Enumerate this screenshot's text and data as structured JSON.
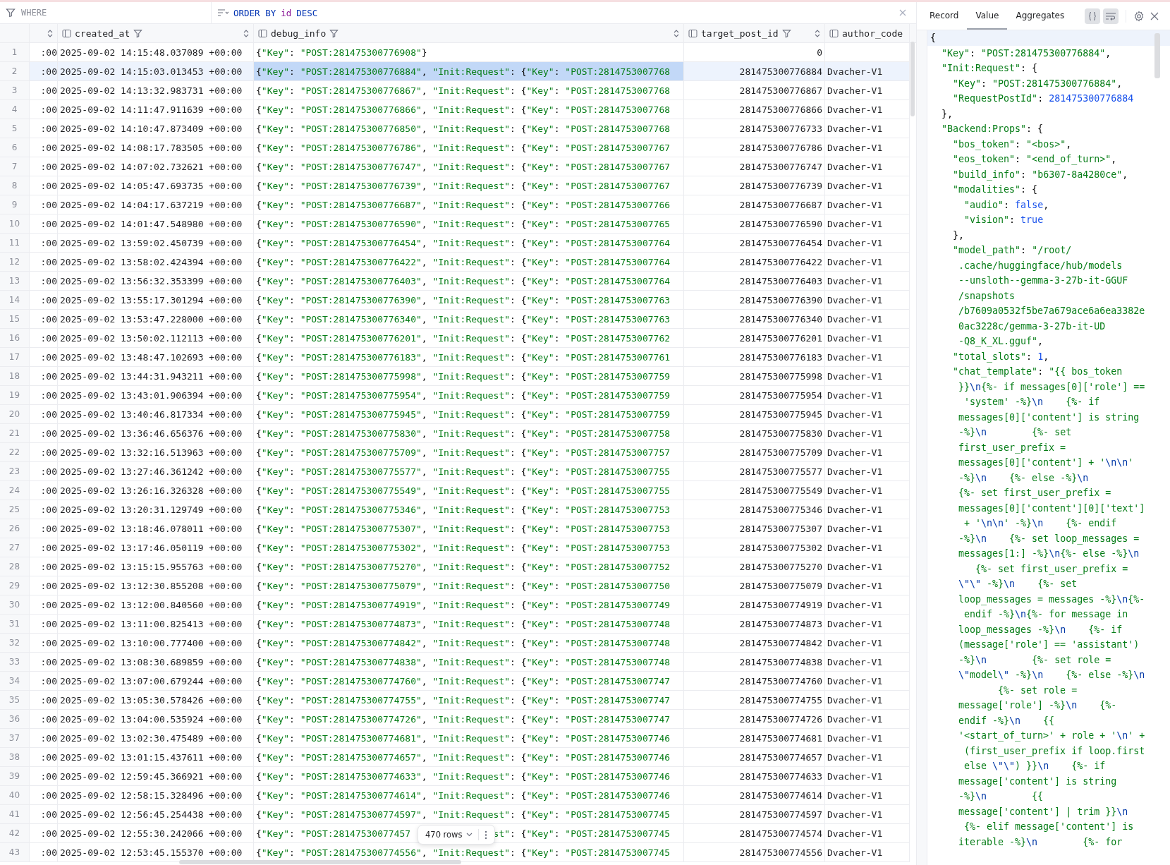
{
  "filter_bar": {
    "where_placeholder": "WHERE",
    "order_by": [
      {
        "text": "ORDER BY",
        "kind": "keyword"
      },
      {
        "text": "id",
        "kind": "identifier"
      },
      {
        "text": "DESC",
        "kind": "keyword"
      }
    ]
  },
  "table": {
    "columns": [
      {
        "sortable": true,
        "filter": false,
        "icon": false
      },
      {
        "name": "created_at",
        "sortable": true,
        "filter": true,
        "icon": true
      },
      {
        "name": "debug_info",
        "sortable": true,
        "filter": true,
        "icon": true
      },
      {
        "name": "target_post_id",
        "sortable": true,
        "filter": true,
        "icon": true
      },
      {
        "name": "author_code",
        "sortable": false,
        "filter": false,
        "icon": true
      }
    ],
    "rows": [
      {
        "number": "1",
        "column_1": ":00",
        "created_at": "2025-09-02 14:15:48.037089 +00:00",
        "debug_info": "{\"Key\": \"POST:281475300776908\"}",
        "target_post_id": "0",
        "selected": false
      },
      {
        "number": "2",
        "column_1": ":00",
        "created_at": "2025-09-02 14:15:03.013453 +00:00",
        "debug_info": "{\"Key\": \"POST:281475300776884\", \"Init:Request\": {\"Key\": \"POST:2814753007768",
        "target_post_id": "281475300776884",
        "author_code": "Dvacher-V1",
        "selected": true
      },
      {
        "number": "3",
        "column_1": ":00",
        "created_at": "2025-09-02 14:13:32.983731 +00:00",
        "debug_info": "{\"Key\": \"POST:281475300776867\", \"Init:Request\": {\"Key\": \"POST:2814753007768",
        "target_post_id": "281475300776867",
        "author_code": "Dvacher-V1",
        "selected": false
      },
      {
        "number": "4",
        "column_1": ":00",
        "created_at": "2025-09-02 14:11:47.911639 +00:00",
        "debug_info": "{\"Key\": \"POST:281475300776866\", \"Init:Request\": {\"Key\": \"POST:2814753007768",
        "target_post_id": "281475300776866",
        "author_code": "Dvacher-V1",
        "selected": false
      },
      {
        "number": "5",
        "column_1": ":00",
        "created_at": "2025-09-02 14:10:47.873409 +00:00",
        "debug_info": "{\"Key\": \"POST:281475300776850\", \"Init:Request\": {\"Key\": \"POST:2814753007768",
        "target_post_id": "281475300776733",
        "author_code": "Dvacher-V1",
        "selected": false
      },
      {
        "number": "6",
        "column_1": ":00",
        "created_at": "2025-09-02 14:08:17.783505 +00:00",
        "debug_info": "{\"Key\": \"POST:281475300776786\", \"Init:Request\": {\"Key\": \"POST:2814753007767",
        "target_post_id": "281475300776786",
        "author_code": "Dvacher-V1",
        "selected": false
      },
      {
        "number": "7",
        "column_1": ":00",
        "created_at": "2025-09-02 14:07:02.732621 +00:00",
        "debug_info": "{\"Key\": \"POST:281475300776747\", \"Init:Request\": {\"Key\": \"POST:2814753007767",
        "target_post_id": "281475300776747",
        "author_code": "Dvacher-V1",
        "selected": false
      },
      {
        "number": "8",
        "column_1": ":00",
        "created_at": "2025-09-02 14:05:47.693735 +00:00",
        "debug_info": "{\"Key\": \"POST:281475300776739\", \"Init:Request\": {\"Key\": \"POST:2814753007767",
        "target_post_id": "281475300776739",
        "author_code": "Dvacher-V1",
        "selected": false
      },
      {
        "number": "9",
        "column_1": ":00",
        "created_at": "2025-09-02 14:04:17.637219 +00:00",
        "debug_info": "{\"Key\": \"POST:281475300776687\", \"Init:Request\": {\"Key\": \"POST:2814753007766",
        "target_post_id": "281475300776687",
        "author_code": "Dvacher-V1",
        "selected": false
      },
      {
        "number": "10",
        "column_1": ":00",
        "created_at": "2025-09-02 14:01:47.548980 +00:00",
        "debug_info": "{\"Key\": \"POST:281475300776590\", \"Init:Request\": {\"Key\": \"POST:2814753007765",
        "target_post_id": "281475300776590",
        "author_code": "Dvacher-V1",
        "selected": false
      },
      {
        "number": "11",
        "column_1": ":00",
        "created_at": "2025-09-02 13:59:02.450739 +00:00",
        "debug_info": "{\"Key\": \"POST:281475300776454\", \"Init:Request\": {\"Key\": \"POST:2814753007764",
        "target_post_id": "281475300776454",
        "author_code": "Dvacher-V1",
        "selected": false
      },
      {
        "number": "12",
        "column_1": ":00",
        "created_at": "2025-09-02 13:58:02.424394 +00:00",
        "debug_info": "{\"Key\": \"POST:281475300776422\", \"Init:Request\": {\"Key\": \"POST:2814753007764",
        "target_post_id": "281475300776422",
        "author_code": "Dvacher-V1",
        "selected": false
      },
      {
        "number": "13",
        "column_1": ":00",
        "created_at": "2025-09-02 13:56:32.353399 +00:00",
        "debug_info": "{\"Key\": \"POST:281475300776403\", \"Init:Request\": {\"Key\": \"POST:2814753007764",
        "target_post_id": "281475300776403",
        "author_code": "Dvacher-V1",
        "selected": false
      },
      {
        "number": "14",
        "column_1": ":00",
        "created_at": "2025-09-02 13:55:17.301294 +00:00",
        "debug_info": "{\"Key\": \"POST:281475300776390\", \"Init:Request\": {\"Key\": \"POST:2814753007763",
        "target_post_id": "281475300776390",
        "author_code": "Dvacher-V1",
        "selected": false
      },
      {
        "number": "15",
        "column_1": ":00",
        "created_at": "2025-09-02 13:53:47.228000 +00:00",
        "debug_info": "{\"Key\": \"POST:281475300776340\", \"Init:Request\": {\"Key\": \"POST:2814753007763",
        "target_post_id": "281475300776340",
        "author_code": "Dvacher-V1",
        "selected": false
      },
      {
        "number": "16",
        "column_1": ":00",
        "created_at": "2025-09-02 13:50:02.112113 +00:00",
        "debug_info": "{\"Key\": \"POST:281475300776201\", \"Init:Request\": {\"Key\": \"POST:2814753007762",
        "target_post_id": "281475300776201",
        "author_code": "Dvacher-V1",
        "selected": false
      },
      {
        "number": "17",
        "column_1": ":00",
        "created_at": "2025-09-02 13:48:47.102693 +00:00",
        "debug_info": "{\"Key\": \"POST:281475300776183\", \"Init:Request\": {\"Key\": \"POST:2814753007761",
        "target_post_id": "281475300776183",
        "author_code": "Dvacher-V1",
        "selected": false
      },
      {
        "number": "18",
        "column_1": ":00",
        "created_at": "2025-09-02 13:44:31.943211 +00:00",
        "debug_info": "{\"Key\": \"POST:281475300775998\", \"Init:Request\": {\"Key\": \"POST:2814753007759",
        "target_post_id": "281475300775998",
        "author_code": "Dvacher-V1",
        "selected": false
      },
      {
        "number": "19",
        "column_1": ":00",
        "created_at": "2025-09-02 13:43:01.906394 +00:00",
        "debug_info": "{\"Key\": \"POST:281475300775954\", \"Init:Request\": {\"Key\": \"POST:2814753007759",
        "target_post_id": "281475300775954",
        "author_code": "Dvacher-V1",
        "selected": false
      },
      {
        "number": "20",
        "column_1": ":00",
        "created_at": "2025-09-02 13:40:46.817334 +00:00",
        "debug_info": "{\"Key\": \"POST:281475300775945\", \"Init:Request\": {\"Key\": \"POST:2814753007759",
        "target_post_id": "281475300775945",
        "author_code": "Dvacher-V1",
        "selected": false
      },
      {
        "number": "21",
        "column_1": ":00",
        "created_at": "2025-09-02 13:36:46.656376 +00:00",
        "debug_info": "{\"Key\": \"POST:281475300775830\", \"Init:Request\": {\"Key\": \"POST:2814753007758",
        "target_post_id": "281475300775830",
        "author_code": "Dvacher-V1",
        "selected": false
      },
      {
        "number": "22",
        "column_1": ":00",
        "created_at": "2025-09-02 13:32:16.513963 +00:00",
        "debug_info": "{\"Key\": \"POST:281475300775709\", \"Init:Request\": {\"Key\": \"POST:2814753007757",
        "target_post_id": "281475300775709",
        "author_code": "Dvacher-V1",
        "selected": false
      },
      {
        "number": "23",
        "column_1": ":00",
        "created_at": "2025-09-02 13:27:46.361242 +00:00",
        "debug_info": "{\"Key\": \"POST:281475300775577\", \"Init:Request\": {\"Key\": \"POST:2814753007755",
        "target_post_id": "281475300775577",
        "author_code": "Dvacher-V1",
        "selected": false
      },
      {
        "number": "24",
        "column_1": ":00",
        "created_at": "2025-09-02 13:26:16.326328 +00:00",
        "debug_info": "{\"Key\": \"POST:281475300775549\", \"Init:Request\": {\"Key\": \"POST:2814753007755",
        "target_post_id": "281475300775549",
        "author_code": "Dvacher-V1",
        "selected": false
      },
      {
        "number": "25",
        "column_1": ":00",
        "created_at": "2025-09-02 13:20:31.129749 +00:00",
        "debug_info": "{\"Key\": \"POST:281475300775346\", \"Init:Request\": {\"Key\": \"POST:2814753007753",
        "target_post_id": "281475300775346",
        "author_code": "Dvacher-V1",
        "selected": false
      },
      {
        "number": "26",
        "column_1": ":00",
        "created_at": "2025-09-02 13:18:46.078011 +00:00",
        "debug_info": "{\"Key\": \"POST:281475300775307\", \"Init:Request\": {\"Key\": \"POST:2814753007753",
        "target_post_id": "281475300775307",
        "author_code": "Dvacher-V1",
        "selected": false
      },
      {
        "number": "27",
        "column_1": ":00",
        "created_at": "2025-09-02 13:17:46.050119 +00:00",
        "debug_info": "{\"Key\": \"POST:281475300775302\", \"Init:Request\": {\"Key\": \"POST:2814753007753",
        "target_post_id": "281475300775302",
        "author_code": "Dvacher-V1",
        "selected": false
      },
      {
        "number": "28",
        "column_1": ":00",
        "created_at": "2025-09-02 13:15:15.955763 +00:00",
        "debug_info": "{\"Key\": \"POST:281475300775270\", \"Init:Request\": {\"Key\": \"POST:2814753007752",
        "target_post_id": "281475300775270",
        "author_code": "Dvacher-V1",
        "selected": false
      },
      {
        "number": "29",
        "column_1": ":00",
        "created_at": "2025-09-02 13:12:30.855208 +00:00",
        "debug_info": "{\"Key\": \"POST:281475300775079\", \"Init:Request\": {\"Key\": \"POST:2814753007750",
        "target_post_id": "281475300775079",
        "author_code": "Dvacher-V1",
        "selected": false
      },
      {
        "number": "30",
        "column_1": ":00",
        "created_at": "2025-09-02 13:12:00.840560 +00:00",
        "debug_info": "{\"Key\": \"POST:281475300774919\", \"Init:Request\": {\"Key\": \"POST:2814753007749",
        "target_post_id": "281475300774919",
        "author_code": "Dvacher-V1",
        "selected": false
      },
      {
        "number": "31",
        "column_1": ":00",
        "created_at": "2025-09-02 13:11:00.825413 +00:00",
        "debug_info": "{\"Key\": \"POST:281475300774873\", \"Init:Request\": {\"Key\": \"POST:2814753007748",
        "target_post_id": "281475300774873",
        "author_code": "Dvacher-V1",
        "selected": false
      },
      {
        "number": "32",
        "column_1": ":00",
        "created_at": "2025-09-02 13:10:00.777400 +00:00",
        "debug_info": "{\"Key\": \"POST:281475300774842\", \"Init:Request\": {\"Key\": \"POST:2814753007748",
        "target_post_id": "281475300774842",
        "author_code": "Dvacher-V1",
        "selected": false
      },
      {
        "number": "33",
        "column_1": ":00",
        "created_at": "2025-09-02 13:08:30.689859 +00:00",
        "debug_info": "{\"Key\": \"POST:281475300774838\", \"Init:Request\": {\"Key\": \"POST:2814753007748",
        "target_post_id": "281475300774838",
        "author_code": "Dvacher-V1",
        "selected": false
      },
      {
        "number": "34",
        "column_1": ":00",
        "created_at": "2025-09-02 13:07:00.679244 +00:00",
        "debug_info": "{\"Key\": \"POST:281475300774760\", \"Init:Request\": {\"Key\": \"POST:2814753007747",
        "target_post_id": "281475300774760",
        "author_code": "Dvacher-V1",
        "selected": false
      },
      {
        "number": "35",
        "column_1": ":00",
        "created_at": "2025-09-02 13:05:30.578426 +00:00",
        "debug_info": "{\"Key\": \"POST:281475300774755\", \"Init:Request\": {\"Key\": \"POST:2814753007747",
        "target_post_id": "281475300774755",
        "author_code": "Dvacher-V1",
        "selected": false
      },
      {
        "number": "36",
        "column_1": ":00",
        "created_at": "2025-09-02 13:04:00.535924 +00:00",
        "debug_info": "{\"Key\": \"POST:281475300774726\", \"Init:Request\": {\"Key\": \"POST:2814753007747",
        "target_post_id": "281475300774726",
        "author_code": "Dvacher-V1",
        "selected": false
      },
      {
        "number": "37",
        "column_1": ":00",
        "created_at": "2025-09-02 13:02:30.475489 +00:00",
        "debug_info": "{\"Key\": \"POST:281475300774681\", \"Init:Request\": {\"Key\": \"POST:2814753007746",
        "target_post_id": "281475300774681",
        "author_code": "Dvacher-V1",
        "selected": false
      },
      {
        "number": "38",
        "column_1": ":00",
        "created_at": "2025-09-02 13:01:15.437611 +00:00",
        "debug_info": "{\"Key\": \"POST:281475300774657\", \"Init:Request\": {\"Key\": \"POST:2814753007746",
        "target_post_id": "281475300774657",
        "author_code": "Dvacher-V1",
        "selected": false
      },
      {
        "number": "39",
        "column_1": ":00",
        "created_at": "2025-09-02 12:59:45.366921 +00:00",
        "debug_info": "{\"Key\": \"POST:281475300774633\", \"Init:Request\": {\"Key\": \"POST:2814753007746",
        "target_post_id": "281475300774633",
        "author_code": "Dvacher-V1",
        "selected": false
      },
      {
        "number": "40",
        "column_1": ":00",
        "created_at": "2025-09-02 12:58:15.328496 +00:00",
        "debug_info": "{\"Key\": \"POST:281475300774614\", \"Init:Request\": {\"Key\": \"POST:2814753007746",
        "target_post_id": "281475300774614",
        "author_code": "Dvacher-V1",
        "selected": false
      },
      {
        "number": "41",
        "column_1": ":00",
        "created_at": "2025-09-02 12:56:45.254438 +00:00",
        "debug_info": "{\"Key\": \"POST:281475300774597\", \"Init:Request\": {\"Key\": \"POST:2814753007745",
        "target_post_id": "281475300774597",
        "author_code": "Dvacher-V1",
        "selected": false
      },
      {
        "number": "42",
        "column_1": ":00",
        "created_at": "2025-09-02 12:55:30.242066 +00:00",
        "debug_info": "{\"Key\": \"POST:28147530077457",
        "debug_info_tail": "st\": {\"Key\": \"POST:2814753007745",
        "target_post_id": "281475300774574",
        "author_code": "Dvacher-V1",
        "selected": false
      },
      {
        "number": "43",
        "column_1": ":00",
        "created_at": "2025-09-02 12:53:45.155370 +00:00",
        "debug_info": "{\"Key\": \"POST:281475300774556\", \"Init:Request\": {\"Key\": \"POST:2814753007745",
        "target_post_id": "281475300774556",
        "author_code": "Dvacher-V1",
        "selected": false
      }
    ],
    "row_count": "470 rows"
  },
  "panel": {
    "tabs": [
      {
        "label": "Record",
        "selected": false
      },
      {
        "label": "Value",
        "selected": true
      },
      {
        "label": "Aggregates",
        "selected": false
      }
    ],
    "toggles": [
      {
        "kind": "braces",
        "on": true
      },
      {
        "kind": "wrap",
        "on": true
      }
    ],
    "lines": [
      {
        "text": "{",
        "current": true
      },
      {
        "text": "  \"Key\": \"POST:281475300776884\",",
        "current": false
      },
      {
        "text": "  \"Init:Request\": {",
        "current": false
      },
      {
        "text": "    \"Key\": \"POST:281475300776884\",",
        "current": false
      },
      {
        "text": "    \"RequestPostId\": 281475300776884",
        "current": false
      },
      {
        "text": "  },",
        "current": false
      },
      {
        "text": "  \"Backend:Props\": {",
        "current": false
      },
      {
        "text": "    \"bos_token\": \"<bos>\",",
        "current": false
      },
      {
        "text": "    \"eos_token\": \"<end_of_turn>\",",
        "current": false
      },
      {
        "text": "    \"build_info\": \"b6307-8a4280ce\",",
        "current": false
      },
      {
        "text": "    \"modalities\": {",
        "current": false
      },
      {
        "text": "      \"audio\": false,",
        "current": false
      },
      {
        "text": "      \"vision\": true",
        "current": false
      },
      {
        "text": "    },",
        "current": false
      },
      {
        "text": "    \"model_path\": \"/root/",
        "current": false
      },
      {
        "text": "     .cache/huggingface/hub/models",
        "current": false
      },
      {
        "text": "     --unsloth--gemma-3-27b-it-GGUF",
        "current": false
      },
      {
        "text": "     /snapshots",
        "current": false
      },
      {
        "text": "     /b7609a0532f5be7a679ace6a6ea3382e",
        "current": false
      },
      {
        "text": "     0ac3228c/gemma-3-27b-it-UD",
        "current": false
      },
      {
        "text": "     -Q8_K_XL.gguf\",",
        "current": false
      },
      {
        "text": "    \"total_slots\": 1,",
        "current": false
      },
      {
        "text": "    \"chat_template\": \"{{ bos_token",
        "current": false
      },
      {
        "text": "     }}\\n{%- if messages[0]['role'] ==",
        "current": false
      },
      {
        "text": "      'system' -%}\\n    {%- if",
        "current": false
      },
      {
        "text": "     messages[0]['content'] is string",
        "current": false
      },
      {
        "text": "     -%}\\n        {%- set",
        "current": false
      },
      {
        "text": "     first_user_prefix =",
        "current": false
      },
      {
        "text": "     messages[0]['content'] + '\\n\\n'",
        "current": false
      },
      {
        "text": "     -%}\\n    {%- else -%}\\n",
        "current": false
      },
      {
        "text": "     {%- set first_user_prefix =",
        "current": false
      },
      {
        "text": "     messages[0]['content'][0]['text']",
        "current": false
      },
      {
        "text": "      + '\\n\\n' -%}\\n    {%- endif",
        "current": false
      },
      {
        "text": "     -%}\\n    {%- set loop_messages =",
        "current": false
      },
      {
        "text": "     messages[1:] -%}\\n{%- else -%}\\n",
        "current": false
      },
      {
        "text": "        {%- set first_user_prefix =",
        "current": false
      },
      {
        "text": "     \\\"\\\" -%}\\n    {%- set",
        "current": false
      },
      {
        "text": "     loop_messages = messages -%}\\n{%-",
        "current": false
      },
      {
        "text": "      endif -%}\\n{%- for message in",
        "current": false
      },
      {
        "text": "     loop_messages -%}\\n    {%- if",
        "current": false
      },
      {
        "text": "     (message['role'] == 'assistant')",
        "current": false
      },
      {
        "text": "     -%}\\n        {%- set role =",
        "current": false
      },
      {
        "text": "     \\\"model\\\" -%}\\n    {%- else -%}\\n",
        "current": false
      },
      {
        "text": "            {%- set role =",
        "current": false
      },
      {
        "text": "     message['role'] -%}\\n    {%-",
        "current": false
      },
      {
        "text": "     endif -%}\\n    {{",
        "current": false
      },
      {
        "text": "     '<start_of_turn>' + role + '\\n' +",
        "current": false
      },
      {
        "text": "      (first_user_prefix if loop.first",
        "current": false
      },
      {
        "text": "      else \\\"\\\") }}\\n    {%- if",
        "current": false
      },
      {
        "text": "     message['content'] is string",
        "current": false
      },
      {
        "text": "     -%}\\n        {{",
        "current": false
      },
      {
        "text": "     message['content'] | trim }}\\n",
        "current": false
      },
      {
        "text": "      {%- elif message['content'] is",
        "current": false
      },
      {
        "text": "     iterable -%}\\n        {%- for",
        "current": false
      }
    ]
  }
}
